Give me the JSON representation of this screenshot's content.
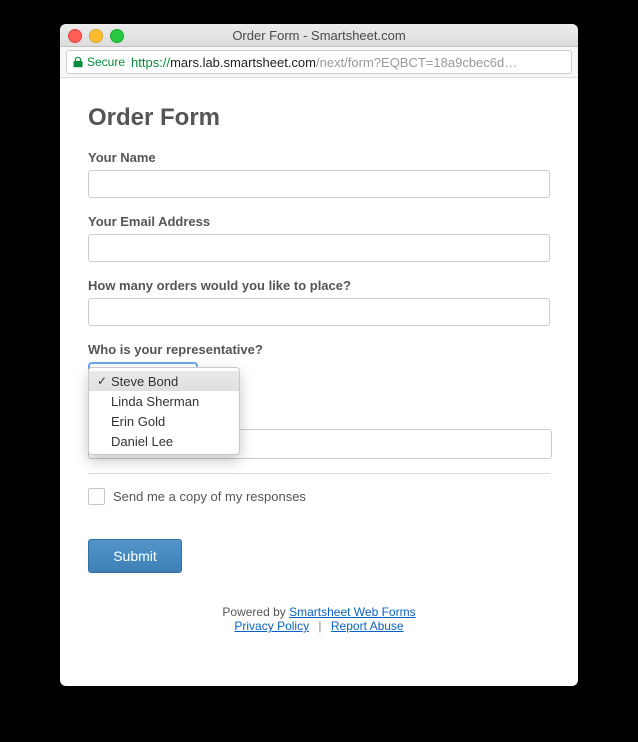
{
  "chrome": {
    "window_title": "Order Form - Smartsheet.com",
    "secure_label": "Secure",
    "url_scheme": "https://",
    "url_host": "mars.lab.smartsheet.com",
    "url_rest": "/next/form?EQBCT=18a9cbec6d…"
  },
  "form": {
    "title": "Order Form",
    "fields": {
      "name": {
        "label": "Your Name"
      },
      "email": {
        "label": "Your Email Address"
      },
      "orders": {
        "label": "How many orders would you like to place?"
      },
      "rep": {
        "label": "Who is your representative?",
        "options": [
          "Steve Bond",
          "Linda Sherman",
          "Erin Gold",
          "Daniel Lee"
        ],
        "selected_index": 0
      }
    },
    "copy_checkbox_label": "Send me a copy of my responses",
    "submit_label": "Submit"
  },
  "footer": {
    "powered_prefix": "Powered by ",
    "powered_link": "Smartsheet Web Forms",
    "privacy": "Privacy Policy",
    "separator": "|",
    "report": "Report Abuse"
  }
}
